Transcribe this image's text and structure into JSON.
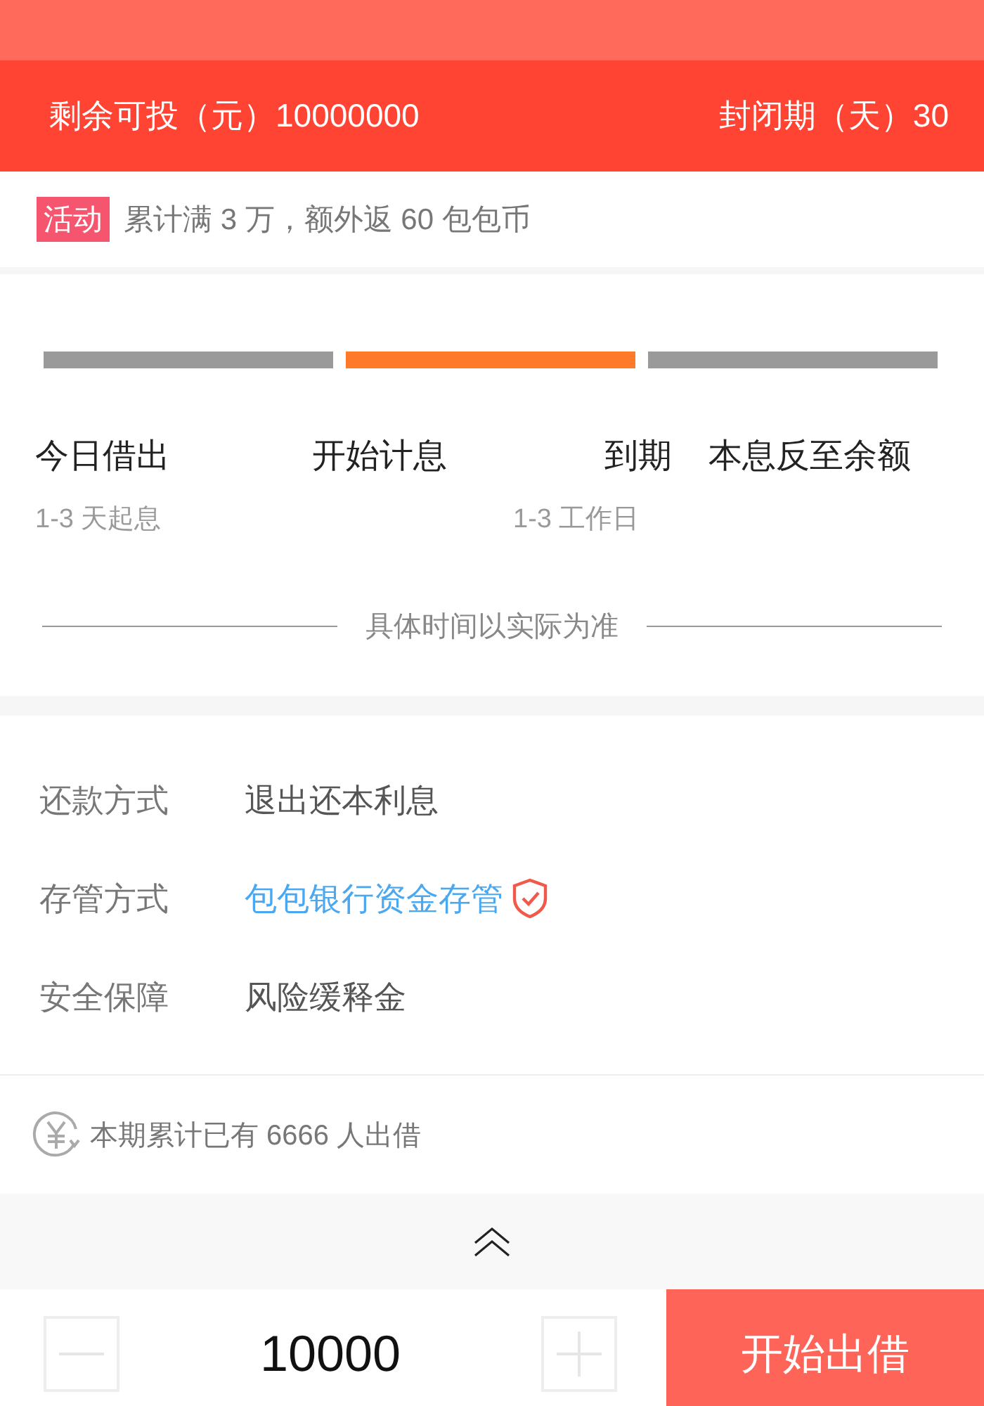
{
  "summary": {
    "remaining": "剩余可投（元）10000000",
    "period": "封闭期（天）30"
  },
  "promo": {
    "badge": "活动",
    "text": "累计满 3 万，额外返 60 包包币"
  },
  "timeline": {
    "stages": [
      {
        "active": false
      },
      {
        "active": true
      },
      {
        "active": false
      }
    ],
    "steps": [
      {
        "label": "今日借出",
        "note": "1-3 天起息"
      },
      {
        "label": "开始计息"
      },
      {
        "label": "到期",
        "note": "1-3 工作日"
      },
      {
        "label": "本息反至余额"
      }
    ],
    "footnote": "具体时间以实际为准"
  },
  "details": [
    {
      "kind": "plain",
      "label": "还款方式",
      "value": "退出还本利息"
    },
    {
      "kind": "link",
      "label": "存管方式",
      "value": "包包银行资金存管"
    },
    {
      "kind": "plain",
      "label": "安全保障",
      "value": "风险缓释金"
    }
  ],
  "investors": "本期累计已有 6666 人出借",
  "order": {
    "amount": "10000",
    "submit": "开始出借"
  }
}
